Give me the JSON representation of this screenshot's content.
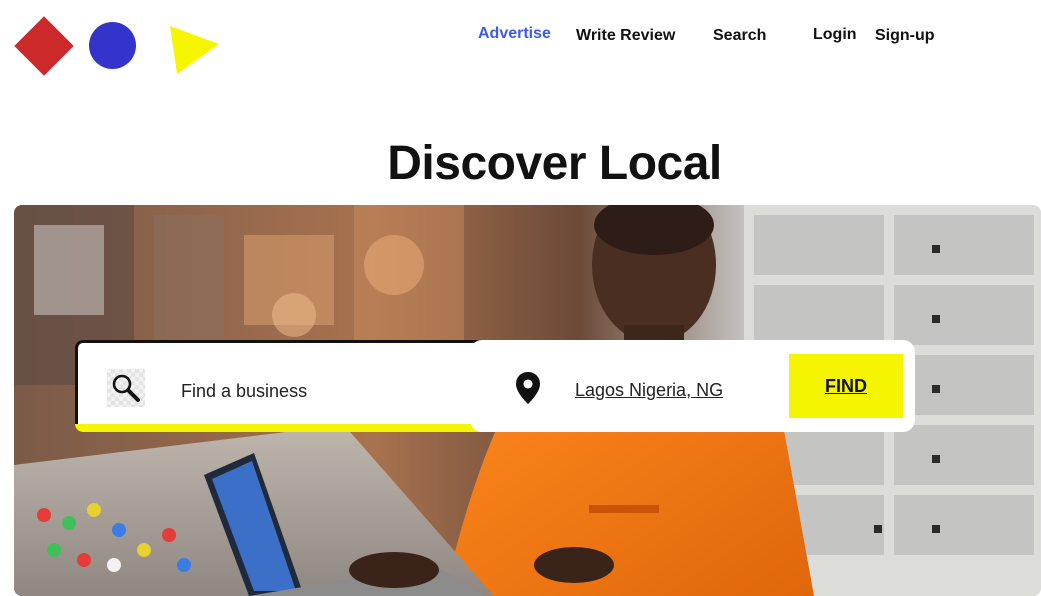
{
  "colors": {
    "logo_diamond": "#cc2a2a",
    "logo_circle": "#3434cc",
    "logo_triangle": "#f7f500",
    "nav_active": "#3d5af1",
    "find_button": "#f5f500"
  },
  "logo": {
    "icons": [
      "red-diamond-icon",
      "blue-circle-icon",
      "yellow-triangle-icon"
    ]
  },
  "nav": {
    "advertise": "Advertise",
    "write_review": "Write Review",
    "search": "Search",
    "login": "Login",
    "signup": "Sign-up"
  },
  "hero": {
    "title": "Discover Local"
  },
  "search": {
    "business_placeholder": "Find a business",
    "business_value": "",
    "location_value": "Lagos Nigeria, NG",
    "find_label": "FIND",
    "search_icon": "magnifier-icon",
    "location_icon": "map-pin-icon"
  }
}
